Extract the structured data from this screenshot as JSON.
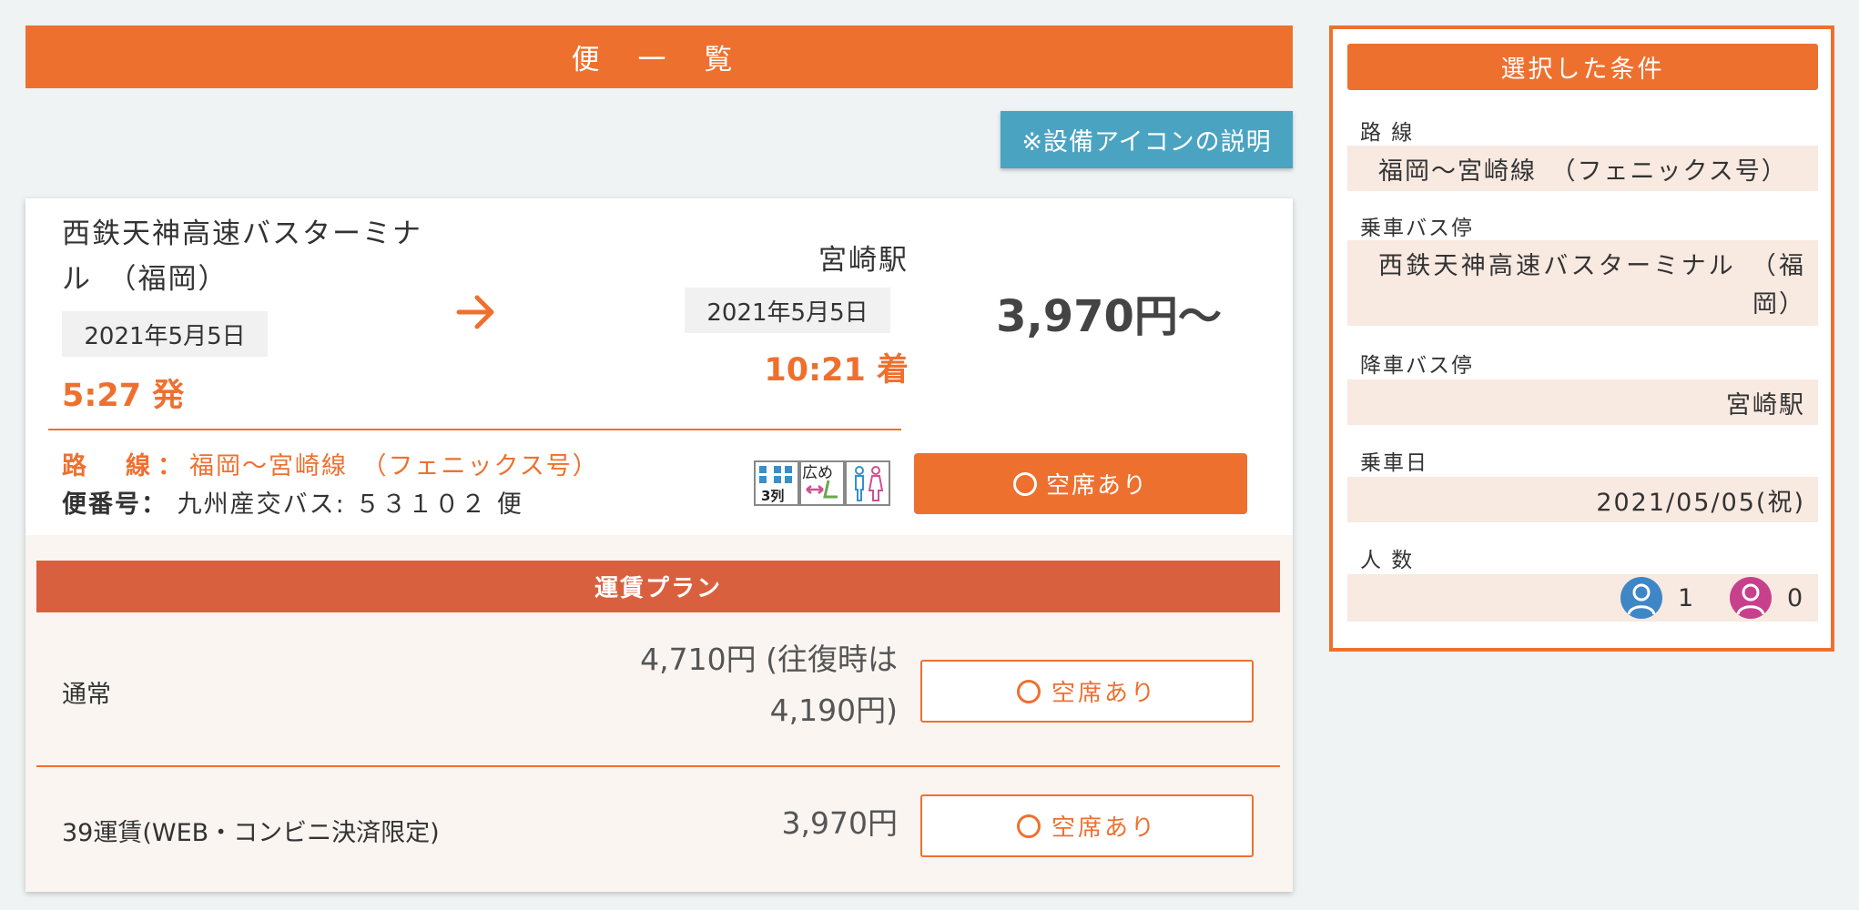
{
  "list": {
    "title": "便 一 覧",
    "icon_help_label": "※設備アイコンの説明"
  },
  "trip": {
    "departure": {
      "name": "西鉄天神高速バスターミナル　（福岡）",
      "date": "2021年5月5日",
      "time": "5:27 発"
    },
    "arrival": {
      "name": "宮崎駅",
      "date": "2021年5月5日",
      "time": "10:21 着"
    },
    "fare_from": "3,970円～",
    "route_label": "路　線：",
    "route_value": "福岡～宮崎線　（フェニックス号）",
    "flight_label": "便番号：",
    "flight_value": "九州産交バス: ５３１０２ 便",
    "facilities": [
      "3列",
      "広め",
      "トイレ"
    ],
    "vacancy_label": "空席あり"
  },
  "plans": {
    "header": "運賃プラン",
    "rows": [
      {
        "name": "通常",
        "price": "4,710円 (往復時は4,190円)",
        "vacancy": "空席あり"
      },
      {
        "name": "39運賃(WEB・コンビニ決済限定)",
        "price": "3,970円",
        "vacancy": "空席あり"
      }
    ]
  },
  "conditions": {
    "title": "選択した条件",
    "route_label": "路 線",
    "route_value": "福岡～宮崎線　（フェニックス号）",
    "board_label": "乗車バス停",
    "board_value": "西鉄天神高速バスターミナル　（福岡）",
    "alight_label": "降車バス停",
    "alight_value": "宮崎駅",
    "date_label": "乗車日",
    "date_value": "2021/05/05(祝)",
    "people_label": "人 数",
    "adult_count": "1",
    "child_count": "0"
  },
  "colors": {
    "accent": "#ee702f",
    "plan_header": "#d9603f",
    "info_button": "#4ba3c2",
    "adult_icon": "#3f86c7",
    "child_icon": "#c8408c"
  }
}
